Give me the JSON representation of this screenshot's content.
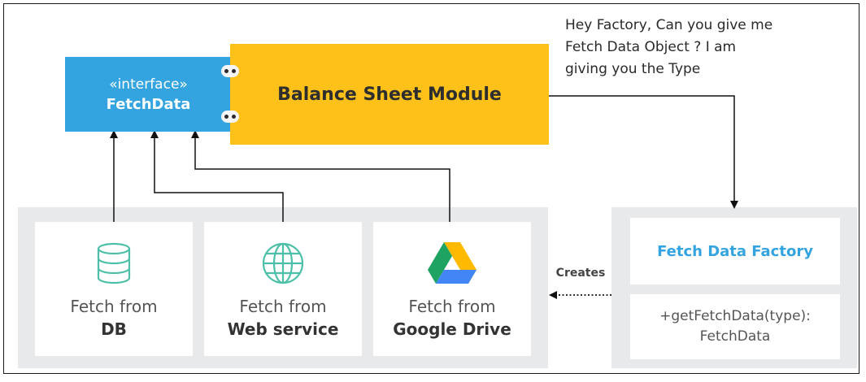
{
  "interface": {
    "stereotype": "«interface»",
    "name": "FetchData"
  },
  "module": {
    "label": "Balance Sheet Module"
  },
  "note": {
    "lines": [
      "Hey Factory, Can you give me",
      "Fetch Data Object ? I am",
      "giving you the Type"
    ]
  },
  "sources": [
    {
      "line1": "Fetch from",
      "line2": "DB",
      "icon": "database-icon"
    },
    {
      "line1": "Fetch from",
      "line2": "Web service",
      "icon": "globe-icon"
    },
    {
      "line1": "Fetch from",
      "line2": "Google Drive",
      "icon": "google-drive-icon"
    }
  ],
  "factory": {
    "title": "Fetch Data Factory",
    "method_line1": "+getFetchData(type):",
    "method_line2": "FetchData"
  },
  "edge_labels": {
    "creates": "Creates"
  },
  "colors": {
    "interface_blue": "#34a4e0",
    "module_yellow": "#fdc119",
    "icon_teal": "#4dbfa8",
    "panel_gray": "#e8e9eb",
    "drive_green": "#1ea362",
    "drive_yellow": "#ffba00",
    "drive_blue": "#4285f4"
  }
}
